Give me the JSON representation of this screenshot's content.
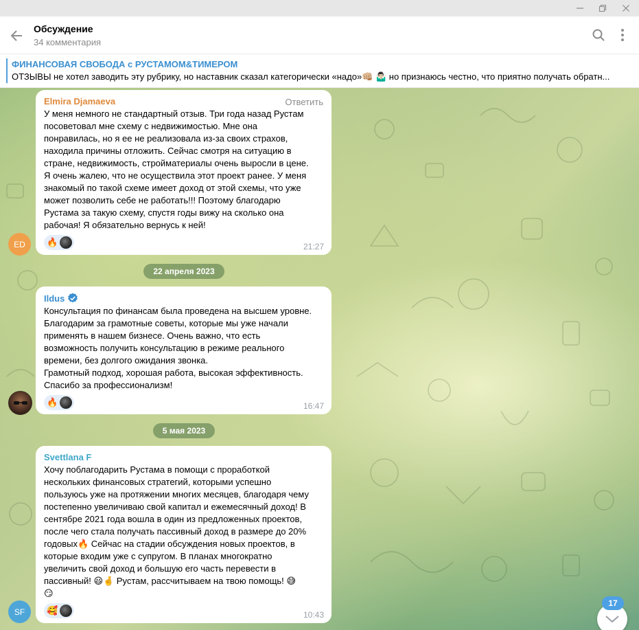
{
  "header": {
    "title": "Обсуждение",
    "subtitle": "34 комментария"
  },
  "pinned": {
    "title": "ФИНАНСОВАЯ СВОБОДА с РУСТАМОМ&ТИМЕРОМ",
    "text": "ОТЗЫВЫ не хотел заводить эту рубрику, но наставник сказал категорически «надо»👊🏼 🤷🏻‍♂️ но признаюсь честно, что приятно получать обратн..."
  },
  "messages": [
    {
      "sender": "Elmira Djamaeva",
      "sender_color": "#e08a3c",
      "reply_label": "Ответить",
      "text": "У меня немного не стандартный отзыв.  Три года назад Рустам\nпосоветовал мне схему с недвижимостью. Мне она\nпонравилась, но я ее не реализовала из-за своих страхов,\nнаходила причины отложить. Сейчас смотря на ситуацию в\nстране, недвижимость, стройматериалы очень выросли в цене.\nЯ очень жалею, что не осуществила этот проект ранее. У меня\nзнакомый по такой схеме имеет доход от этой схемы, что уже\nможет позволить себе не работать!!! Поэтому благодарю\nРустама за такую схему, спустя годы вижу на сколько она\nрабочая! Я обязательно вернусь к ней!",
      "reaction": "🔥",
      "time": "21:27",
      "avatar_initials": "ED",
      "avatar_color": "#f0a04b"
    },
    {
      "sender": "Ildus",
      "sender_color": "#3a8fd0",
      "verified": true,
      "text": "Консультация по финансам была проведена на высшем уровне.\nБлагодарим за грамотные советы, которые мы уже начали\nприменять в нашем бизнесе. Очень важно, что есть\nвозможность получить консультацию в режиме реального\nвремени, без долгого ожидания звонка.\nГрамотный подход, хорошая работа, высокая эффективность.\nСпасибо за профессионализм!",
      "reaction": "🔥",
      "time": "16:47"
    },
    {
      "sender": "Svettlana F",
      "sender_color": "#3fa7c9",
      "text": "Хочу поблагодарить Рустама в помощи с проработкой\nнескольких финансовых стратегий, которыми успешно\nпользуюсь уже на протяжении многих месяцев, благодаря чему\nпостепенно увеличиваю свой капитал и ежемесячный доход! В\nсентябре 2021 года вошла в один из предложенных проектов,\nпосле чего стала получать пассивный доход в размере до 20%\nгодовых🔥 Сейчас на стадии обсуждения новых проектов, в\nкоторые входим уже с супругом. В планах многократно\nувеличить свой доход и большую его часть перевести в\nпассивный! 😃🤞 Рустам, рассчитываем на твою помощь! 😅\n😏",
      "reaction": "🥰",
      "time": "10:43",
      "avatar_initials": "SF",
      "avatar_color": "#4ea6d8"
    }
  ],
  "dates": [
    "22 апреля 2023",
    "5 мая 2023"
  ],
  "unread_count": "17"
}
